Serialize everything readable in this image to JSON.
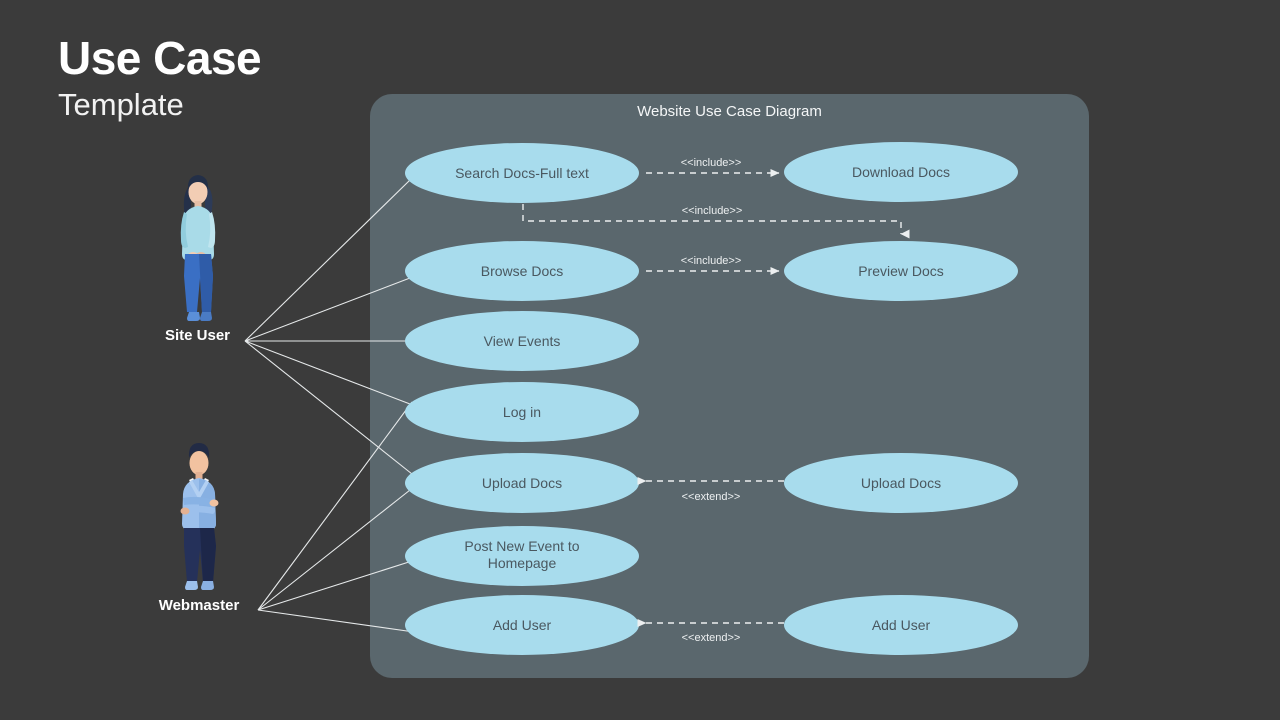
{
  "heading": {
    "title": "Use Case",
    "subtitle": "Template"
  },
  "diagram": {
    "title": "Website Use Case Diagram",
    "panel_color": "#5a676d",
    "page_background": "#3b3b3b",
    "ellipse_color": "#a8dced",
    "ellipse_text_color": "#4a5860",
    "connector_color": "#eceff0"
  },
  "actors": [
    {
      "id": "site-user",
      "label": "Site User"
    },
    {
      "id": "webmaster",
      "label": "Webmaster"
    }
  ],
  "use_cases": {
    "left": [
      {
        "id": "search-docs-full-text",
        "label": "Search Docs-Full text",
        "line2": ""
      },
      {
        "id": "browse-docs",
        "label": "Browse Docs",
        "line2": ""
      },
      {
        "id": "view-events",
        "label": "View Events",
        "line2": ""
      },
      {
        "id": "log-in",
        "label": "Log in",
        "line2": ""
      },
      {
        "id": "upload-docs",
        "label": "Upload Docs",
        "line2": ""
      },
      {
        "id": "post-new-event-to-homepage",
        "label": "Post New Event to",
        "line2": "Homepage"
      },
      {
        "id": "add-user",
        "label": "Add User",
        "line2": ""
      }
    ],
    "right": [
      {
        "id": "download-docs",
        "label": "Download Docs",
        "line2": ""
      },
      {
        "id": "preview-docs",
        "label": "Preview Docs",
        "line2": ""
      },
      {
        "id": "upload-docs-ext",
        "label": "Upload Docs",
        "line2": ""
      },
      {
        "id": "add-user-ext",
        "label": "Add User",
        "line2": ""
      }
    ]
  },
  "relationships": [
    {
      "id": "rel-search-download",
      "stereotype": "<<include>>"
    },
    {
      "id": "rel-search-preview",
      "stereotype": "<<include>>"
    },
    {
      "id": "rel-browse-preview",
      "stereotype": "<<include>>"
    },
    {
      "id": "rel-upload-extend",
      "stereotype": "<<extend>>"
    },
    {
      "id": "rel-adduser-extend",
      "stereotype": "<<extend>>"
    }
  ]
}
